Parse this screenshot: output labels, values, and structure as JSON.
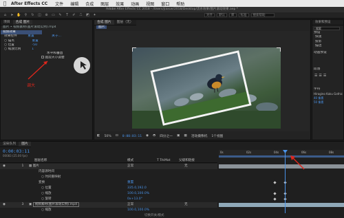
{
  "menubar": {
    "apple": "⌘",
    "app": "After Effects CC",
    "items": [
      "文件",
      "编辑",
      "合成",
      "图层",
      "效果",
      "动画",
      "视图",
      "窗口",
      "帮助"
    ]
  },
  "window_title": "Adobe After Effects CC 2018 - /Users/jiaxue/2018/Desktop/流水效果/图片滚动效果.aep *",
  "toolbar": {
    "fields": [
      "对齐",
      "默认",
      "库",
      "标准"
    ],
    "search_placeholder": "搜索帮助"
  },
  "project_panel": {
    "tab": "项目",
    "composition_tab": "合成 图片",
    "header_path": "图片 • 视频素材(图片滚动实例).mp4",
    "section": "视频效果",
    "rows": [
      {
        "label": "效果控件",
        "value": "重置",
        "extra": "关于..."
      },
      {
        "label": "○ 锚点",
        "value": "重置",
        "extra": ""
      },
      {
        "label": "○ 位置",
        "value": "-50",
        "extra": ""
      },
      {
        "label": "○ 缩放比例",
        "value": "↓",
        "extra": ""
      },
      {
        "label": "",
        "value": "水平和垂直",
        "extra": ""
      },
      {
        "label": "",
        "value": "图层大小调整",
        "extra": ""
      }
    ],
    "annotation": "调大"
  },
  "viewer": {
    "tab": "合成 图片",
    "layer_tab": "图层（无）",
    "breadcrumb": "图片",
    "zoom": "50%",
    "timecode": "0:00:03:11",
    "quality": "四分之一",
    "camera": "活动摄像机",
    "views": "1个视图"
  },
  "right_panel": {
    "title": "效果和预设",
    "sections": [
      "预设",
      "动画预设",
      "段落",
      "字符"
    ],
    "items": [
      "快速",
      "投影",
      "描边"
    ],
    "search_placeholder": "搜索",
    "font_name": "Hiragino Kaku Gothic",
    "font_size": "40 像素",
    "tracking": "50 像素"
  },
  "timeline": {
    "tabs": [
      "渲染队列",
      "图片"
    ],
    "timecode": "0:00:03:11",
    "sub_timecode": "00083 (25.00 fps)",
    "columns": [
      "图层名称",
      "模式",
      "T TrkMat",
      "父级和链接"
    ],
    "layers": [
      {
        "num": "1",
        "name": "图片",
        "mode": "正常",
        "parent": "无"
      },
      {
        "num": "",
        "name": "内容源时间",
        "mode": "",
        "parent": ""
      },
      {
        "num": "",
        "name": "○ 时间重映射",
        "mode": "",
        "parent": ""
      },
      {
        "num": "",
        "name": "变换",
        "mode": "重置",
        "parent": ""
      },
      {
        "num": "",
        "name": "○ 位置",
        "mode": "335.0,192.0",
        "parent": ""
      },
      {
        "num": "",
        "name": "○ 缩放",
        "mode": "100.0,100.0%",
        "parent": ""
      },
      {
        "num": "",
        "name": "○ 旋转",
        "mode": "0x+13.0°",
        "parent": ""
      },
      {
        "num": "3",
        "name": "视频素材(图片滚动实例).mp4",
        "mode": "正常",
        "parent": "无"
      },
      {
        "num": "",
        "name": "○ 缩放",
        "mode": "100.0,100.0%",
        "parent": ""
      }
    ],
    "ruler_labels": [
      "0s",
      "02s",
      "04s",
      "06s",
      "08s"
    ],
    "footer": "切换开关/模式"
  },
  "colors": {
    "accent_blue": "#4a93e8",
    "annotation_red": "#e0261c",
    "layer_bar": "#8fa8b8"
  }
}
